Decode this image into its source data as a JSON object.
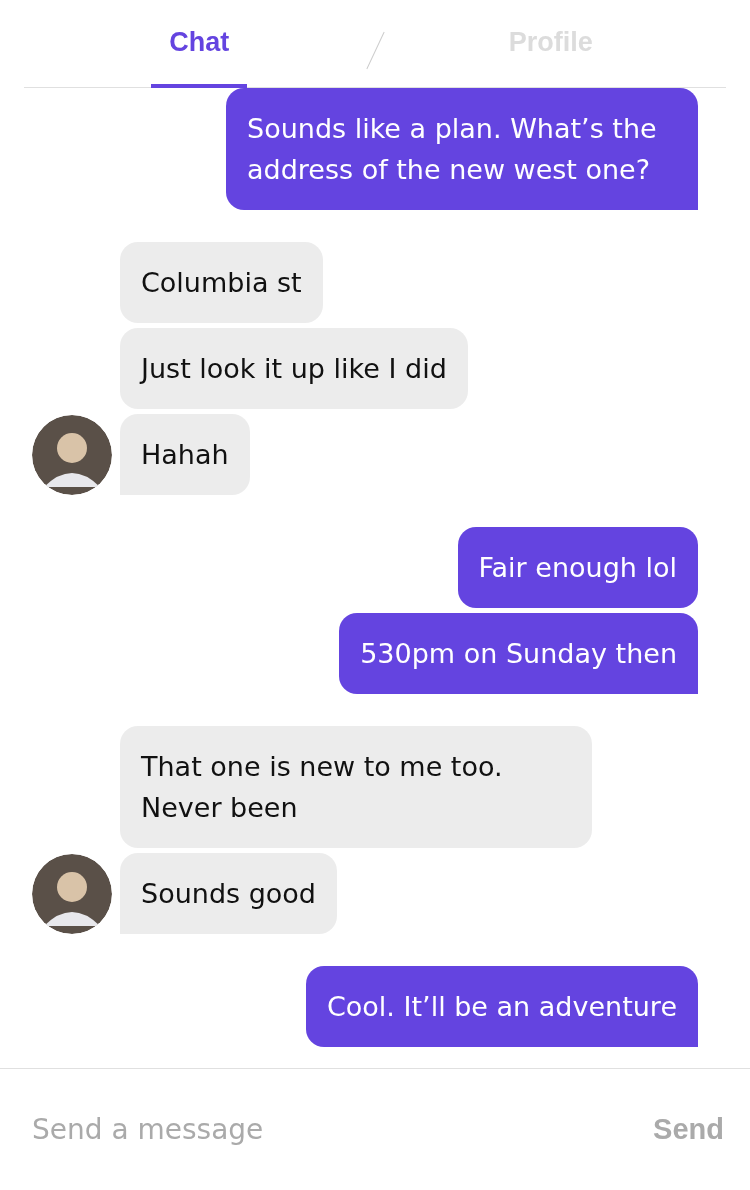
{
  "tabs": [
    {
      "label": "Chat",
      "selected": true
    },
    {
      "label": "Profile",
      "selected": false
    }
  ],
  "groups": [
    {
      "kind": "outgoing",
      "messages": [
        {
          "text": "Sounds like a plan. What’s the address of the new west one?"
        }
      ]
    },
    {
      "kind": "incoming",
      "messages": [
        {
          "text": "Columbia st"
        },
        {
          "text": "Just look it up like I did"
        },
        {
          "text": "Hahah"
        }
      ]
    },
    {
      "kind": "outgoing",
      "messages": [
        {
          "text": "Fair enough lol"
        },
        {
          "text": "530pm on Sunday then"
        }
      ]
    },
    {
      "kind": "incoming",
      "messages": [
        {
          "text": "That one is new to me too. Never been"
        },
        {
          "text": "Sounds good"
        }
      ]
    },
    {
      "kind": "outgoing",
      "messages": [
        {
          "text": "Cool. It’ll be an adventure"
        }
      ]
    }
  ],
  "composer": {
    "placeholder": "Send a message",
    "button": "Send"
  }
}
